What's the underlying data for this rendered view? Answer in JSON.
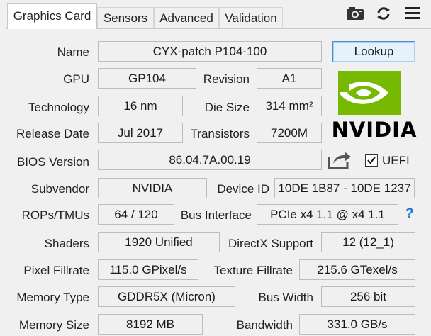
{
  "tabs": [
    "Graphics Card",
    "Sensors",
    "Advanced",
    "Validation"
  ],
  "labels": {
    "name": "Name",
    "gpu": "GPU",
    "revision": "Revision",
    "technology": "Technology",
    "die_size": "Die Size",
    "release_date": "Release Date",
    "transistors": "Transistors",
    "bios_version": "BIOS Version",
    "uefi": "UEFI",
    "subvendor": "Subvendor",
    "device_id": "Device ID",
    "rops_tmus": "ROPs/TMUs",
    "bus_interface": "Bus Interface",
    "shaders": "Shaders",
    "directx": "DirectX Support",
    "pixel_fillrate": "Pixel Fillrate",
    "texture_fillrate": "Texture Fillrate",
    "memory_type": "Memory Type",
    "bus_width": "Bus Width",
    "memory_size": "Memory Size",
    "bandwidth": "Bandwidth"
  },
  "values": {
    "name": "CYX-patch P104-100",
    "gpu": "GP104",
    "revision": "A1",
    "technology": "16 nm",
    "die_size": "314 mm²",
    "release_date": "Jul 2017",
    "transistors": "7200M",
    "bios_version": "86.04.7A.00.19",
    "subvendor": "NVIDIA",
    "device_id": "10DE 1B87 - 10DE 1237",
    "rops_tmus": "64 / 120",
    "bus_interface": "PCIe x4 1.1 @ x4 1.1",
    "shaders": "1920 Unified",
    "directx": "12 (12_1)",
    "pixel_fillrate": "115.0 GPixel/s",
    "texture_fillrate": "215.6 GTexel/s",
    "memory_type": "GDDR5X (Micron)",
    "bus_width": "256 bit",
    "memory_size": "8192 MB",
    "bandwidth": "331.0 GB/s"
  },
  "lookup_label": "Lookup",
  "uefi_checked": true,
  "help_glyph": "?",
  "logo_text": "NVIDIA",
  "icons": [
    "camera-icon",
    "refresh-icon",
    "menu-icon",
    "share-icon",
    "help-icon"
  ],
  "colors": {
    "nvidia_green": "#76b900",
    "accent_blue": "#1e78d6"
  }
}
